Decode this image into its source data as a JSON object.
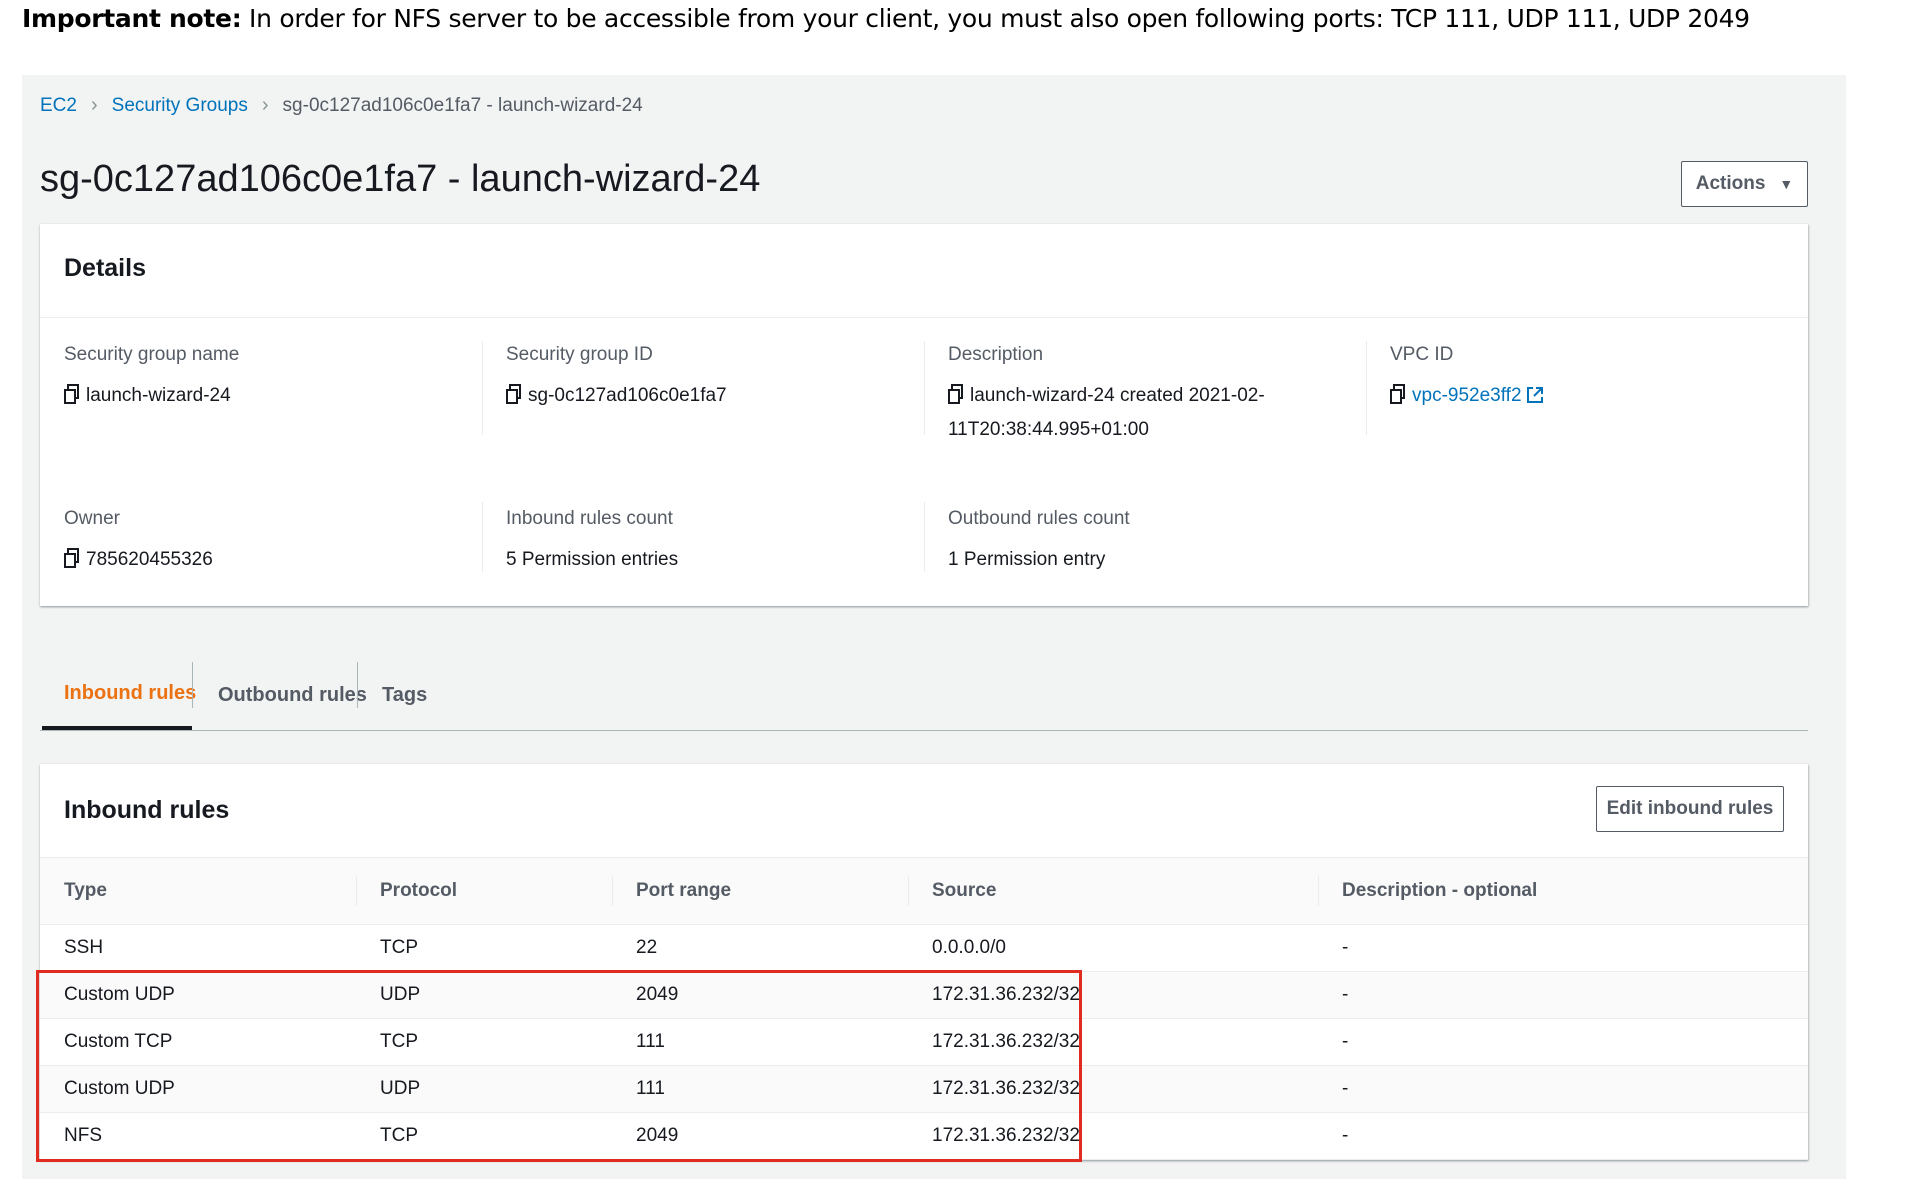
{
  "note": {
    "bold": "Important note:",
    "text": " In order for NFS server to be accessible from your client, you must also open following ports: TCP 111, UDP 111, UDP 2049"
  },
  "breadcrumb": {
    "items": [
      "EC2",
      "Security Groups",
      "sg-0c127ad106c0e1fa7 - launch-wizard-24"
    ]
  },
  "page_title": "sg-0c127ad106c0e1fa7 - launch-wizard-24",
  "actions_label": "Actions",
  "details": {
    "title": "Details",
    "fields": [
      {
        "label": "Security group name",
        "value": "launch-wizard-24"
      },
      {
        "label": "Security group ID",
        "value": "sg-0c127ad106c0e1fa7"
      },
      {
        "label": "Description",
        "value_line1": "launch-wizard-24 created 2021-02-",
        "value_line2": "11T20:38:44.995+01:00"
      },
      {
        "label": "VPC ID",
        "value": "vpc-952e3ff2"
      },
      {
        "label": "Owner",
        "value": "785620455326"
      },
      {
        "label": "Inbound rules count",
        "value": "5 Permission entries"
      },
      {
        "label": "Outbound rules count",
        "value": "1 Permission entry"
      }
    ]
  },
  "tabs": [
    {
      "label": "Inbound rules",
      "active": true
    },
    {
      "label": "Outbound rules",
      "active": false
    },
    {
      "label": "Tags",
      "active": false
    }
  ],
  "inbound": {
    "title": "Inbound rules",
    "edit_label": "Edit inbound rules",
    "columns": [
      "Type",
      "Protocol",
      "Port range",
      "Source",
      "Description - optional"
    ],
    "rows": [
      [
        "SSH",
        "TCP",
        "22",
        "0.0.0.0/0",
        "-"
      ],
      [
        "Custom UDP",
        "UDP",
        "2049",
        "172.31.36.232/32",
        "-"
      ],
      [
        "Custom TCP",
        "TCP",
        "111",
        "172.31.36.232/32",
        "-"
      ],
      [
        "Custom UDP",
        "UDP",
        "111",
        "172.31.36.232/32",
        "-"
      ],
      [
        "NFS",
        "TCP",
        "2049",
        "172.31.36.232/32",
        "-"
      ]
    ]
  },
  "colors": {
    "link": "#0073bb",
    "active_tab": "#ec7211",
    "highlight_box": "#e02b20",
    "panel_bg": "#f2f3f3"
  },
  "icons": [
    "copy-icon",
    "external-link-icon",
    "chevron-right-icon",
    "caret-down-icon"
  ]
}
